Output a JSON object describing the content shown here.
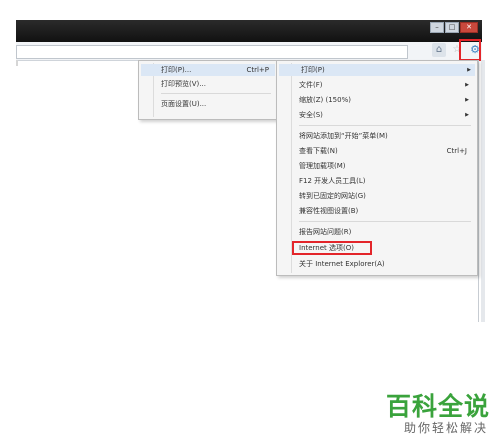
{
  "window": {
    "minimize": "–",
    "maximize": "□",
    "close": "✕"
  },
  "toolbar": {
    "home_icon": "⌂",
    "favorites_icon": "☆",
    "tools_icon": "⚙"
  },
  "submenu": {
    "items": [
      {
        "label": "打印(P)...",
        "shortcut": "Ctrl+P"
      },
      {
        "label": "打印预览(V)..."
      },
      {
        "label": "页面设置(U)..."
      }
    ]
  },
  "menu": {
    "items": [
      {
        "label": "打印(P)",
        "arrow": "▶"
      },
      {
        "label": "文件(F)",
        "arrow": "▶"
      },
      {
        "label": "缩放(Z) (150%)",
        "arrow": "▶"
      },
      {
        "label": "安全(S)",
        "arrow": "▶"
      },
      {
        "label": "将网站添加到“开始”菜单(M)"
      },
      {
        "label": "查看下载(N)",
        "shortcut": "Ctrl+J"
      },
      {
        "label": "管理加载项(M)"
      },
      {
        "label": "F12 开发人员工具(L)"
      },
      {
        "label": "转到已固定的网站(G)"
      },
      {
        "label": "兼容性视图设置(B)"
      },
      {
        "label": "报告网站问题(R)"
      },
      {
        "label": "Internet 选项(O)"
      },
      {
        "label": "关于 Internet Explorer(A)"
      }
    ]
  },
  "watermark": {
    "title": "百科全说",
    "subtitle": "助你轻松解决"
  }
}
